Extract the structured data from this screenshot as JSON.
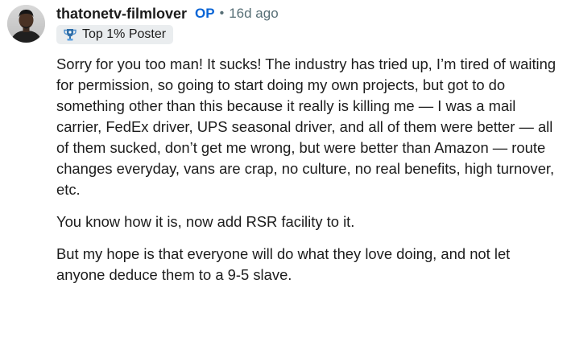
{
  "comment": {
    "username": "thatonetv-filmlover",
    "op_badge": "OP",
    "separator": "•",
    "timestamp": "16d ago",
    "flair": {
      "icon": "trophy-icon",
      "label": "Top 1% Poster"
    },
    "paragraphs": [
      "Sorry for you too man! It sucks! The industry has tried up, I’m tired of waiting for permission, so going to start doing my own projects, but got to do something other than this because it really is killing me — I was a mail carrier, FedEx driver, UPS seasonal driver, and all of them were better — all of them sucked, don’t get me wrong, but were better than Amazon — route changes everyday, vans are crap, no culture, no real benefits, high turnover, etc.",
      "You know how it is, now add RSR facility to it.",
      "But my hope is that everyone will do what they love doing, and not let anyone deduce them to a 9-5 slave."
    ]
  },
  "colors": {
    "op": "#0a65d6",
    "meta": "#576f76",
    "flair_bg": "#eaedef",
    "text": "#1c1c1c"
  }
}
